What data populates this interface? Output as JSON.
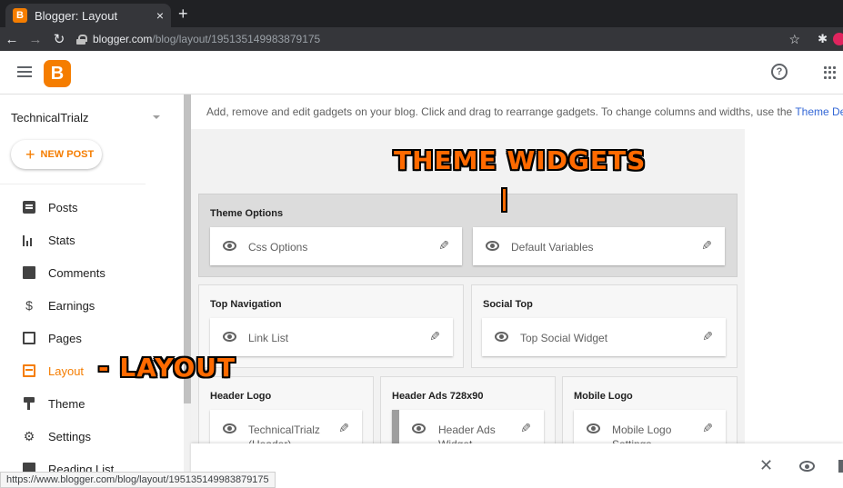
{
  "browser": {
    "tab_title": "Blogger: Layout",
    "tab_close": "×",
    "new_tab": "+",
    "url_host": "blogger.com",
    "url_path": "/blog/layout/195135149983879175",
    "status_url": "https://www.blogger.com/blog/layout/195135149983879175"
  },
  "header": {
    "logo_letter": "B",
    "help_glyph": "?"
  },
  "sidebar": {
    "blog_name": "TechnicalTrialz",
    "new_post_label": "NEW POST",
    "items": [
      {
        "label": "Posts",
        "icon": "posts-icon"
      },
      {
        "label": "Stats",
        "icon": "stats-icon"
      },
      {
        "label": "Comments",
        "icon": "comments-icon"
      },
      {
        "label": "Earnings",
        "icon": "earnings-icon"
      },
      {
        "label": "Pages",
        "icon": "pages-icon"
      },
      {
        "label": "Layout",
        "icon": "layout-icon",
        "active": true
      },
      {
        "label": "Theme",
        "icon": "theme-icon"
      },
      {
        "label": "Settings",
        "icon": "settings-icon"
      },
      {
        "label": "Reading List",
        "icon": "reading-list-icon"
      }
    ]
  },
  "main": {
    "description": "Add, remove and edit gadgets on your blog. Click and drag to rearrange gadgets. To change columns and widths, use the ",
    "description_link": "Theme Des",
    "sections": {
      "theme_options": {
        "title": "Theme Options",
        "gadgets": [
          "Css Options",
          "Default Variables"
        ]
      },
      "top_navigation": {
        "title": "Top Navigation",
        "gadgets": [
          "Link List"
        ]
      },
      "social_top": {
        "title": "Social Top",
        "gadgets": [
          "Top Social Widget"
        ]
      },
      "header_logo": {
        "title": "Header Logo",
        "gadgets": [
          "TechnicalTrialz (Header)"
        ]
      },
      "header_ads": {
        "title": "Header Ads 728x90",
        "gadgets": [
          "Header Ads Widget"
        ]
      },
      "mobile_logo": {
        "title": "Mobile Logo",
        "gadgets": [
          "Mobile Logo Settings"
        ]
      }
    }
  },
  "bottom_bar": {
    "close_glyph": "✕"
  },
  "overlays": {
    "theme_widgets": "THEME WIDGETS",
    "layout": "- LAYOUT"
  },
  "colors": {
    "accent": "#f57d00",
    "overlay": "#ff6a00",
    "link": "#3367d6"
  }
}
